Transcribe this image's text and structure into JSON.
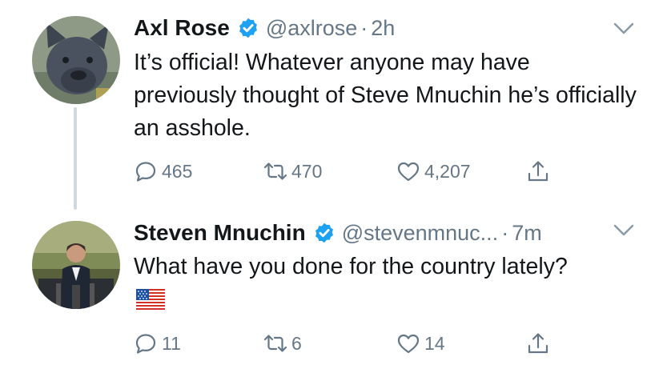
{
  "tweets": [
    {
      "name": "Axl Rose",
      "handle": "@axlrose",
      "separator": "·",
      "time": "2h",
      "text": "It’s official! Whatever anyone may have previously thought of Steve Mnuchin he’s officially an asshole.",
      "replies": "465",
      "retweets": "470",
      "likes": "4,207"
    },
    {
      "name": "Steven Mnuchin",
      "handle": "@stevenmnuc...",
      "separator": "·",
      "time": "7m",
      "text": "What have you done for the country lately?",
      "emoji": "us-flag",
      "replies": "11",
      "retweets": "6",
      "likes": "14"
    }
  ],
  "colors": {
    "text": "#14171a",
    "secondary": "#657786",
    "verified": "#1da1f2",
    "thread_line": "#cfd9de"
  },
  "icons": [
    "verified-badge-icon",
    "chevron-down-icon",
    "reply-icon",
    "retweet-icon",
    "like-icon",
    "share-icon"
  ]
}
